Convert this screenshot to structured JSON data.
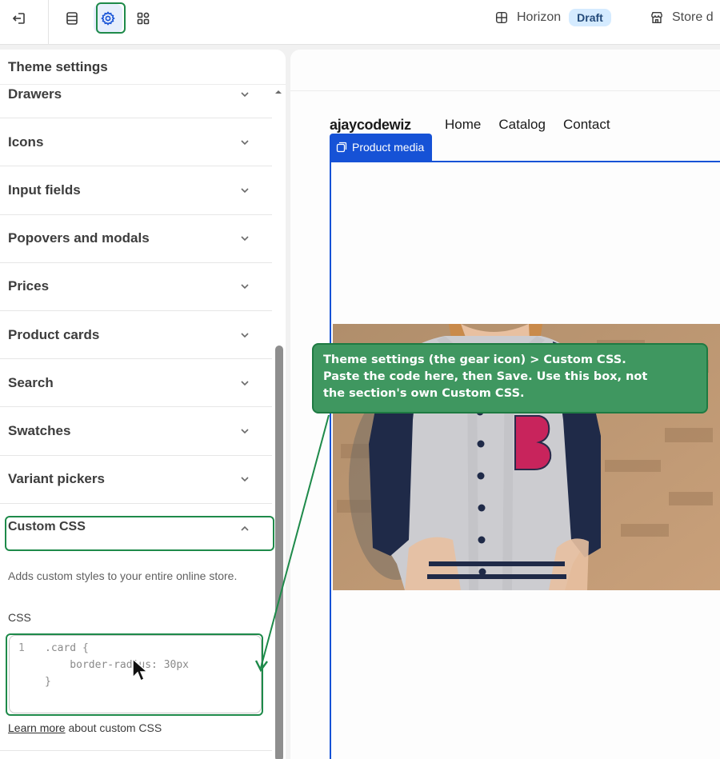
{
  "topbar": {
    "theme_name": "Horizon",
    "theme_status": "Draft",
    "store_label": "Store d",
    "icons": [
      "exit-icon",
      "sections-icon",
      "gear-icon",
      "apps-icon",
      "layout-icon",
      "store-icon"
    ]
  },
  "sidebar": {
    "title": "Theme settings",
    "items": [
      {
        "label": "Drawers"
      },
      {
        "label": "Icons"
      },
      {
        "label": "Input fields"
      },
      {
        "label": "Popovers and modals"
      },
      {
        "label": "Prices"
      },
      {
        "label": "Product cards"
      },
      {
        "label": "Search"
      },
      {
        "label": "Swatches"
      },
      {
        "label": "Variant pickers"
      }
    ],
    "custom_css": {
      "label": "Custom CSS",
      "description": "Adds custom styles to your entire online store.",
      "css_label": "CSS",
      "code": {
        "line_number": "1",
        "line1": ".card {",
        "line2": "    border-radius: 30px",
        "line3": "}"
      },
      "learn_more_link": "Learn more",
      "learn_more_rest": " about custom CSS"
    }
  },
  "preview": {
    "brand": "ajaycodewiz",
    "nav": [
      "Home",
      "Catalog",
      "Contact"
    ],
    "product_media_label": "Product media"
  },
  "callout": {
    "text_line1": "Theme settings (the gear icon) > Custom CSS.",
    "text_line2": "Paste the code here, then Save. Use this box, not",
    "text_line3": "the section's own Custom CSS."
  },
  "colors": {
    "highlight": "#1e8a4a",
    "callout_bg": "#3f9760",
    "selection_blue": "#1652d6",
    "draft_badge": "#d5ebff"
  }
}
